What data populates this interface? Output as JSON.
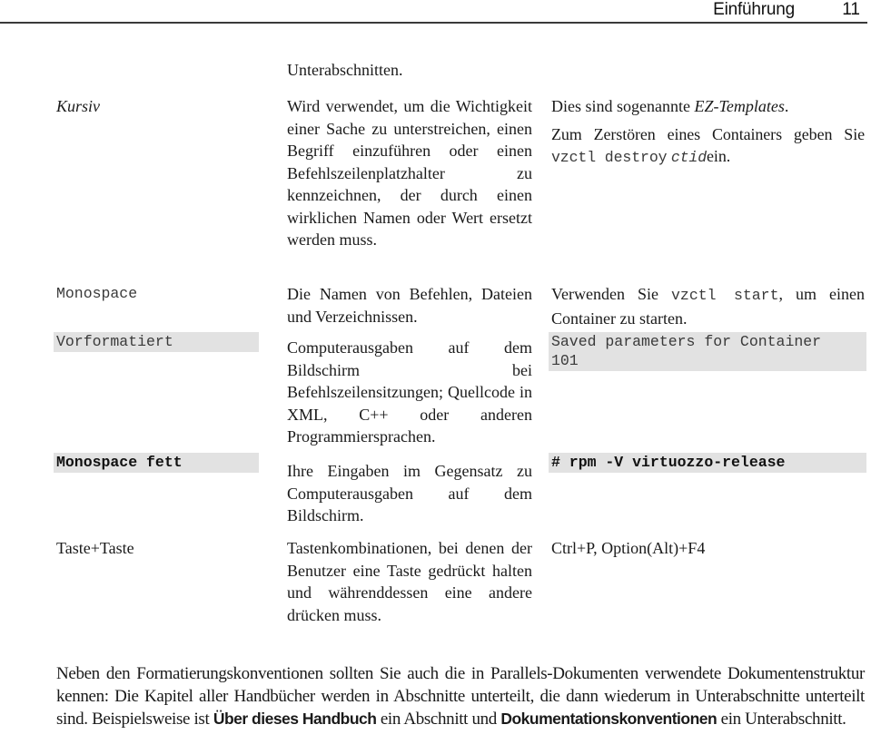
{
  "header": {
    "chapter_title": "Einführung",
    "page_number": "11"
  },
  "table": {
    "continued_text": "Unterabschnitten.",
    "rows": [
      {
        "convention": "Kursiv",
        "description": "Wird verwendet, um die Wichtigkeit einer Sache zu unterstreichen, einen Begriff einzuführen oder einen Befehlszeilenplatzhalter zu kennzeichnen, der durch einen wirklichen Namen oder Wert ersetzt werden muss.",
        "example": {
          "line1_prefix": "Dies sind sogenannte ",
          "line1_italic": "EZ-Templates",
          "line1_suffix": ".",
          "line2_prefix": "Zum Zerstören eines Containers geben Sie ",
          "line2_code": "vzctl destroy",
          "line2_code_italic": "ctid",
          "line2_suffix": "ein."
        }
      },
      {
        "convention": "Monospace",
        "description": "Die Namen von Befehlen, Dateien und Verzeichnissen.",
        "example": {
          "prefix": "Verwenden Sie ",
          "code": "vzctl start",
          "suffix": ", um einen Container zu starten."
        }
      },
      {
        "convention": "Vorformatiert",
        "description": "Computerausgaben auf dem Bildschirm bei Befehlszeilensitzungen; Quellcode in XML, C++ oder anderen Programmiersprachen.",
        "example": {
          "line1": "Saved parameters for Container",
          "line2": "101"
        }
      },
      {
        "convention": "Monospace fett",
        "description": "Ihre Eingaben im Gegensatz zu Computerausgaben auf dem Bildschirm.",
        "example": {
          "code": "# rpm -V virtuozzo-release"
        }
      },
      {
        "convention": "Taste+Taste",
        "description": "Tastenkombinationen, bei denen der Benutzer eine Taste gedrückt halten und währenddessen eine andere drücken muss.",
        "example": {
          "text": "Ctrl+P, Option(Alt)+F4"
        }
      }
    ]
  },
  "paragraph": {
    "part1": "Neben den Formatierungskonventionen sollten Sie auch die in Parallels-Dokumenten verwendete Dokumentenstruktur kennen: Die Kapitel aller Handbücher werden in Abschnitte unterteilt, die dann wiederum in Unterabschnitte unterteilt sind. Beispielsweise ist ",
    "bold1": "Über dieses Handbuch",
    "part2": " ein Abschnitt und ",
    "bold2": "Dokumentationskonventionen",
    "part3": " ein Unterabschnitt."
  }
}
